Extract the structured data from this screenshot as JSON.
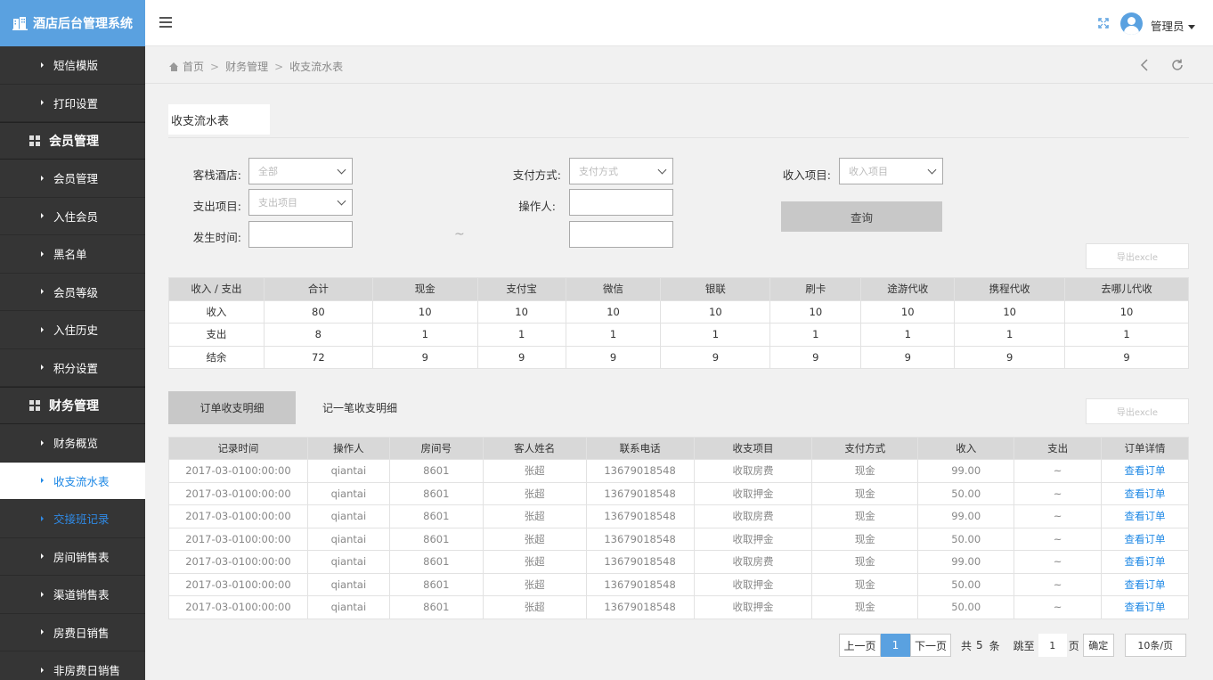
{
  "app": {
    "title": "酒店后台管理系统"
  },
  "sidebar": {
    "groups": [
      {
        "items": [
          {
            "label": "短信模版"
          },
          {
            "label": "打印设置"
          }
        ]
      },
      {
        "header": "会员管理",
        "items": [
          {
            "label": "会员管理"
          },
          {
            "label": "入住会员"
          },
          {
            "label": "黑名单"
          },
          {
            "label": "会员等级"
          },
          {
            "label": "入住历史"
          },
          {
            "label": "积分设置"
          }
        ]
      },
      {
        "header": "财务管理",
        "items": [
          {
            "label": "财务概览"
          },
          {
            "label": "收支流水表"
          },
          {
            "label": "交接班记录"
          },
          {
            "label": "房间销售表"
          },
          {
            "label": "渠道销售表"
          },
          {
            "label": "房费日销售"
          },
          {
            "label": "非房费日销售"
          }
        ]
      }
    ]
  },
  "topbar": {
    "user": "管理员"
  },
  "breadcrumb": {
    "items": [
      "首页",
      "财务管理",
      "收支流水表"
    ]
  },
  "page_tab": "收支流水表",
  "filters": {
    "hotel": {
      "label": "客栈酒店:",
      "value": "全部"
    },
    "pay_method": {
      "label": "支付方式:",
      "placeholder": "支付方式"
    },
    "income_item": {
      "label": "收入项目:",
      "placeholder": "收入项目"
    },
    "expense_item": {
      "label": "支出项目:",
      "placeholder": "支出项目"
    },
    "operator": {
      "label": "操作人:"
    },
    "time": {
      "label": "发生时间:",
      "separator": "~"
    },
    "query_button": "查询",
    "export_button": "导出excle"
  },
  "summary": {
    "headers": [
      "收入 / 支出",
      "合计",
      "现金",
      "支付宝",
      "微信",
      "银联",
      "刷卡",
      "途游代收",
      "携程代收",
      "去哪儿代收"
    ],
    "rows": [
      [
        "收入",
        "80",
        "10",
        "10",
        "10",
        "10",
        "10",
        "10",
        "10",
        "10"
      ],
      [
        "支出",
        "8",
        "1",
        "1",
        "1",
        "1",
        "1",
        "1",
        "1",
        "1"
      ],
      [
        "结余",
        "72",
        "9",
        "9",
        "9",
        "9",
        "9",
        "9",
        "9",
        "9"
      ]
    ]
  },
  "subtabs": [
    "订单收支明细",
    "记一笔收支明细"
  ],
  "export_button2": "导出excle",
  "detail": {
    "headers": [
      "记录时间",
      "操作人",
      "房间号",
      "客人姓名",
      "联系电话",
      "收支项目",
      "支付方式",
      "收入",
      "支出",
      "订单详情"
    ],
    "rows": [
      [
        "2017-03-0100:00:00",
        "qiantai",
        "8601",
        "张超",
        "13679018548",
        "收取房费",
        "现金",
        "99.00",
        "~",
        "查看订单"
      ],
      [
        "2017-03-0100:00:00",
        "qiantai",
        "8601",
        "张超",
        "13679018548",
        "收取押金",
        "现金",
        "50.00",
        "~",
        "查看订单"
      ],
      [
        "2017-03-0100:00:00",
        "qiantai",
        "8601",
        "张超",
        "13679018548",
        "收取房费",
        "现金",
        "99.00",
        "~",
        "查看订单"
      ],
      [
        "2017-03-0100:00:00",
        "qiantai",
        "8601",
        "张超",
        "13679018548",
        "收取押金",
        "现金",
        "50.00",
        "~",
        "查看订单"
      ],
      [
        "2017-03-0100:00:00",
        "qiantai",
        "8601",
        "张超",
        "13679018548",
        "收取房费",
        "现金",
        "99.00",
        "~",
        "查看订单"
      ],
      [
        "2017-03-0100:00:00",
        "qiantai",
        "8601",
        "张超",
        "13679018548",
        "收取押金",
        "现金",
        "50.00",
        "~",
        "查看订单"
      ],
      [
        "2017-03-0100:00:00",
        "qiantai",
        "8601",
        "张超",
        "13679018548",
        "收取押金",
        "现金",
        "50.00",
        "~",
        "查看订单"
      ]
    ]
  },
  "pagination": {
    "prev": "上一页",
    "current": "1",
    "next": "下一页",
    "total_prefix": "共",
    "total": "5",
    "total_suffix": "条",
    "jump_prefix": "跳至",
    "jump_value": "1",
    "jump_suffix": "页",
    "confirm": "确定",
    "page_size": "10条/页"
  },
  "colors": {
    "accent": "#5aa1e0",
    "sidebar_bg": "#353535",
    "link": "#1e88e5"
  }
}
